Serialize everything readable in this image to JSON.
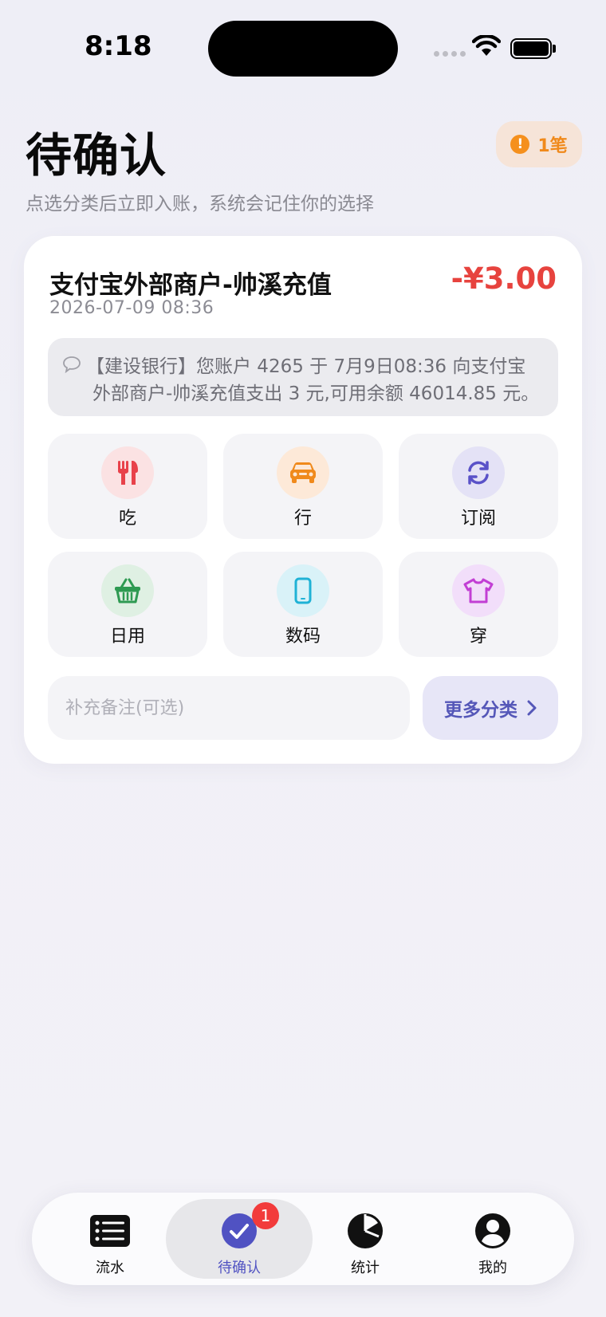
{
  "status_bar": {
    "time": "8:18"
  },
  "header": {
    "title": "待确认",
    "subtitle": "点选分类后立即入账，系统会记住你的选择",
    "pending_count": "1笔"
  },
  "transaction": {
    "merchant": "支付宝外部商户-帅溪充值",
    "amount": "-¥3.00",
    "datetime": "2026-07-09 08:36",
    "sms_line1": "【建设银行】您账户 4265 于 7月9日08:36 向支付宝",
    "sms_line2": "外部商户-帅溪充值支出 3 元,可用余额 46014.85 元。"
  },
  "categories": [
    {
      "label": "吃",
      "icon": "fork-knife-icon",
      "color": "#e8414a",
      "bg": "#fbe2e3"
    },
    {
      "label": "行",
      "icon": "car-icon",
      "color": "#f08a1c",
      "bg": "#fde9d8"
    },
    {
      "label": "订阅",
      "icon": "refresh-icon",
      "color": "#5a52c8",
      "bg": "#e4e2f6"
    },
    {
      "label": "日用",
      "icon": "basket-icon",
      "color": "#2e9a52",
      "bg": "#dff0e3"
    },
    {
      "label": "数码",
      "icon": "phone-icon",
      "color": "#1fb2d6",
      "bg": "#d9f2f8"
    },
    {
      "label": "穿",
      "icon": "shirt-icon",
      "color": "#c23fd4",
      "bg": "#f2defa"
    }
  ],
  "note": {
    "placeholder": "补充备注(可选)"
  },
  "more_button": {
    "label": "更多分类"
  },
  "tabs": [
    {
      "label": "流水",
      "icon": "list-icon"
    },
    {
      "label": "待确认",
      "icon": "check-circle-icon",
      "badge": "1"
    },
    {
      "label": "统计",
      "icon": "pie-chart-icon"
    },
    {
      "label": "我的",
      "icon": "person-icon"
    }
  ],
  "colors": {
    "accent": "#5052c2",
    "expense": "#e7433e",
    "warning": "#f5901d"
  }
}
